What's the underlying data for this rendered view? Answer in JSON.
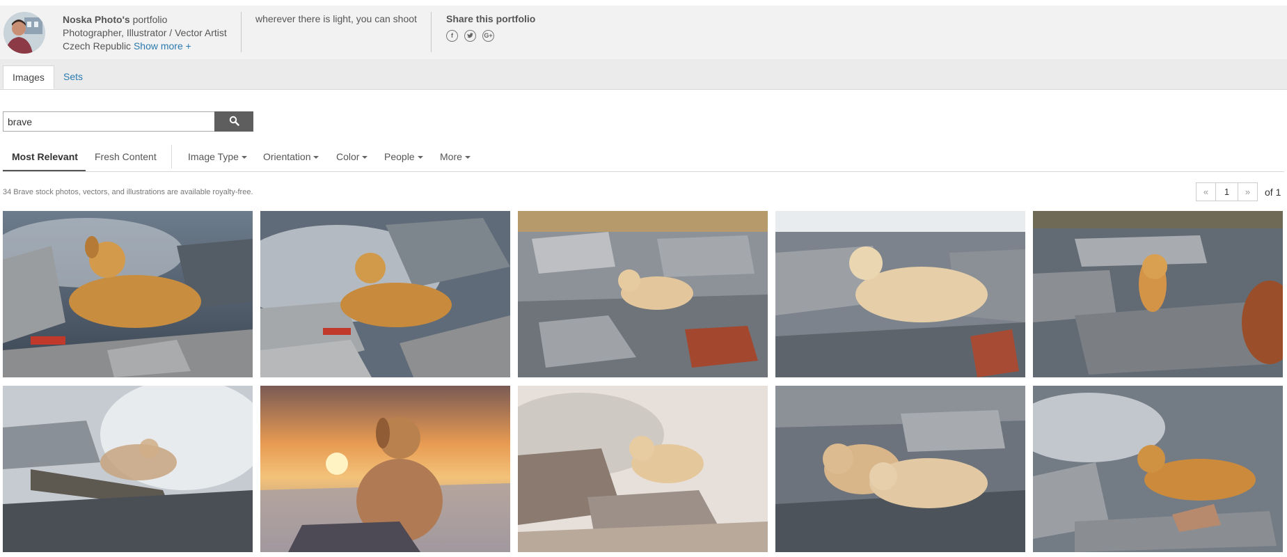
{
  "profile": {
    "name": "Noska Photo's",
    "name_suffix": " portfolio",
    "roles": "Photographer, Illustrator / Vector Artist",
    "location": "Czech Republic",
    "show_more": "Show more +",
    "tagline": "wherever there is light, you can shoot"
  },
  "share": {
    "title": "Share this portfolio",
    "icons": [
      "facebook-icon",
      "twitter-icon",
      "google-plus-icon"
    ]
  },
  "tabs": [
    {
      "label": "Images",
      "active": true
    },
    {
      "label": "Sets",
      "active": false
    }
  ],
  "search": {
    "value": "brave",
    "button_icon": "search-icon"
  },
  "filters": {
    "sort": [
      {
        "label": "Most Relevant",
        "active": true
      },
      {
        "label": "Fresh Content",
        "active": false
      }
    ],
    "dropdowns": [
      "Image Type",
      "Orientation",
      "Color",
      "People",
      "More"
    ]
  },
  "results": {
    "summary": "34 Brave stock photos, vectors, and illustrations are available royalty-free."
  },
  "pager": {
    "prev": "«",
    "page": "1",
    "next": "»",
    "of": "of 1"
  },
  "colors": {
    "link": "#2a7ab0",
    "header_bg": "#f2f2f2",
    "tab_bg": "#ebebeb",
    "search_button": "#5e5e5e"
  }
}
